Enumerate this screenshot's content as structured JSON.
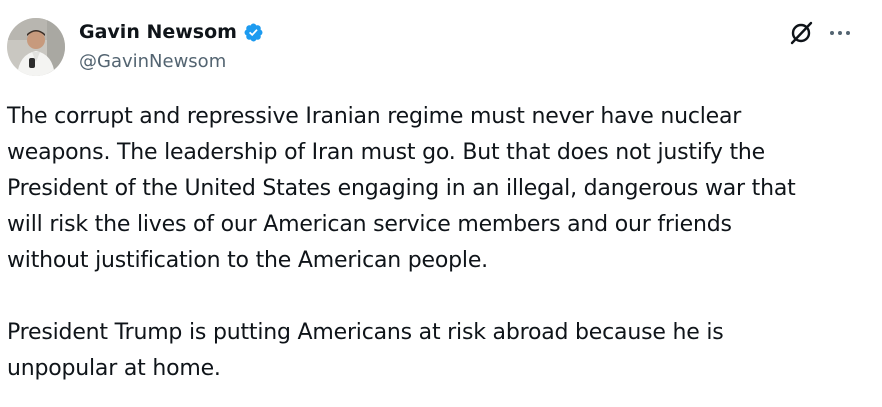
{
  "author": {
    "display_name": "Gavin Newsom",
    "handle": "@GavinNewsom",
    "verified": true,
    "verified_color": "#1d9bf0"
  },
  "actions": {
    "grok_icon": "grok-icon",
    "more_icon": "more-horizontal-icon"
  },
  "tweet": {
    "paragraphs": [
      "The corrupt and repressive Iranian regime must never have nuclear\nweapons. The leadership of Iran must go. But that does not justify the\nPresident of the United States engaging in an illegal, dangerous war that\nwill risk the lives of our American service members and our friends\nwithout justification to the American people.",
      "President Trump is putting Americans at risk abroad because he is\nunpopular at home."
    ]
  }
}
